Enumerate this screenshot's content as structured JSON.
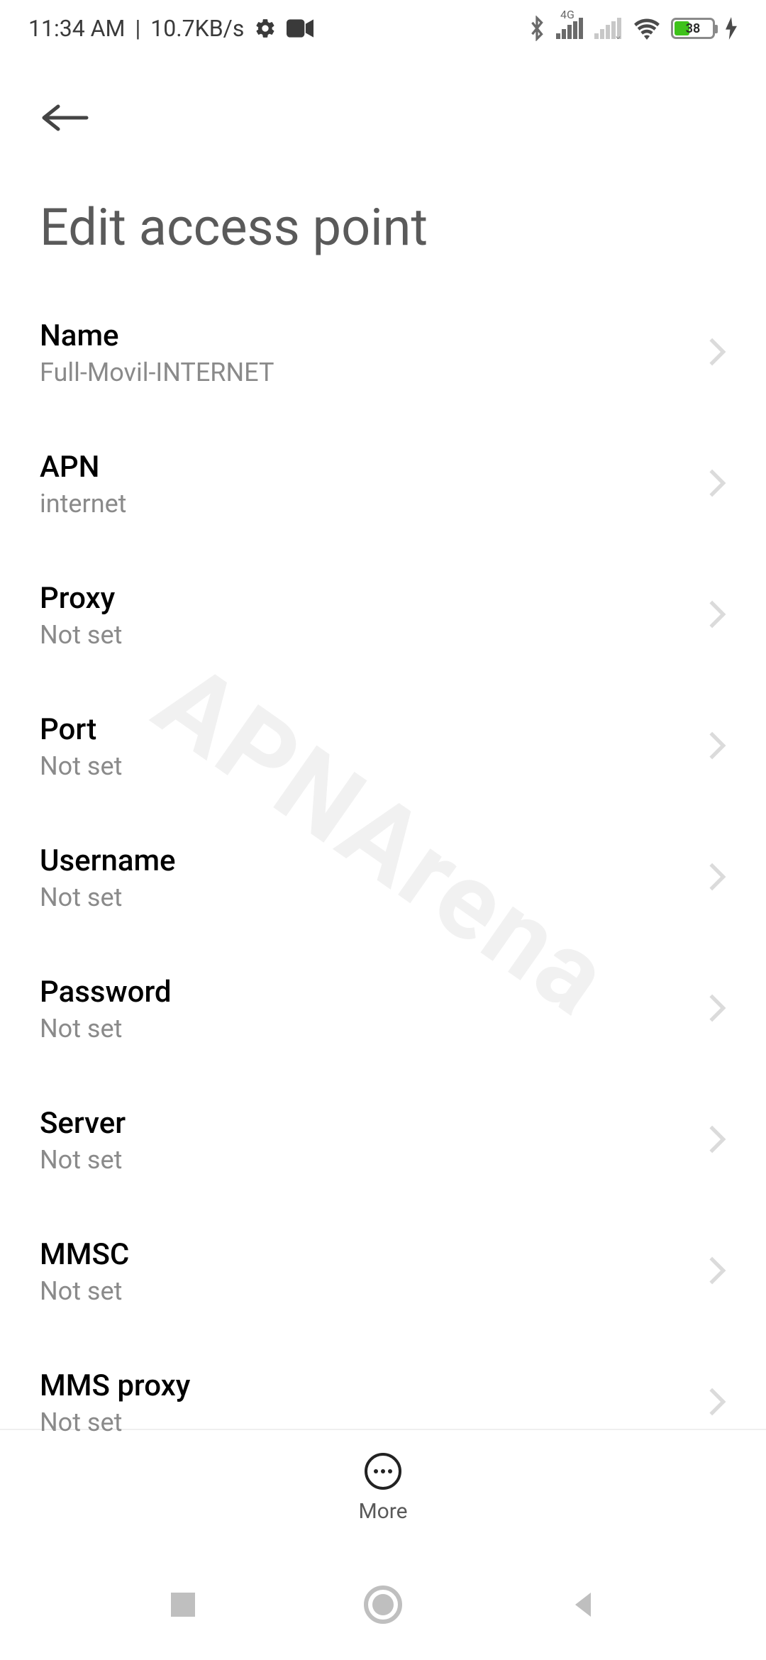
{
  "status": {
    "time": "11:34 AM",
    "speed": "10.7KB/s",
    "battery_percent": "38"
  },
  "header": {
    "title": "Edit access point"
  },
  "settings": [
    {
      "label": "Name",
      "value": "Full-Movil-INTERNET"
    },
    {
      "label": "APN",
      "value": "internet"
    },
    {
      "label": "Proxy",
      "value": "Not set"
    },
    {
      "label": "Port",
      "value": "Not set"
    },
    {
      "label": "Username",
      "value": "Not set"
    },
    {
      "label": "Password",
      "value": "Not set"
    },
    {
      "label": "Server",
      "value": "Not set"
    },
    {
      "label": "MMSC",
      "value": "Not set"
    },
    {
      "label": "MMS proxy",
      "value": "Not set"
    }
  ],
  "bottom": {
    "more_label": "More"
  },
  "watermark": {
    "text": "APNArena"
  }
}
